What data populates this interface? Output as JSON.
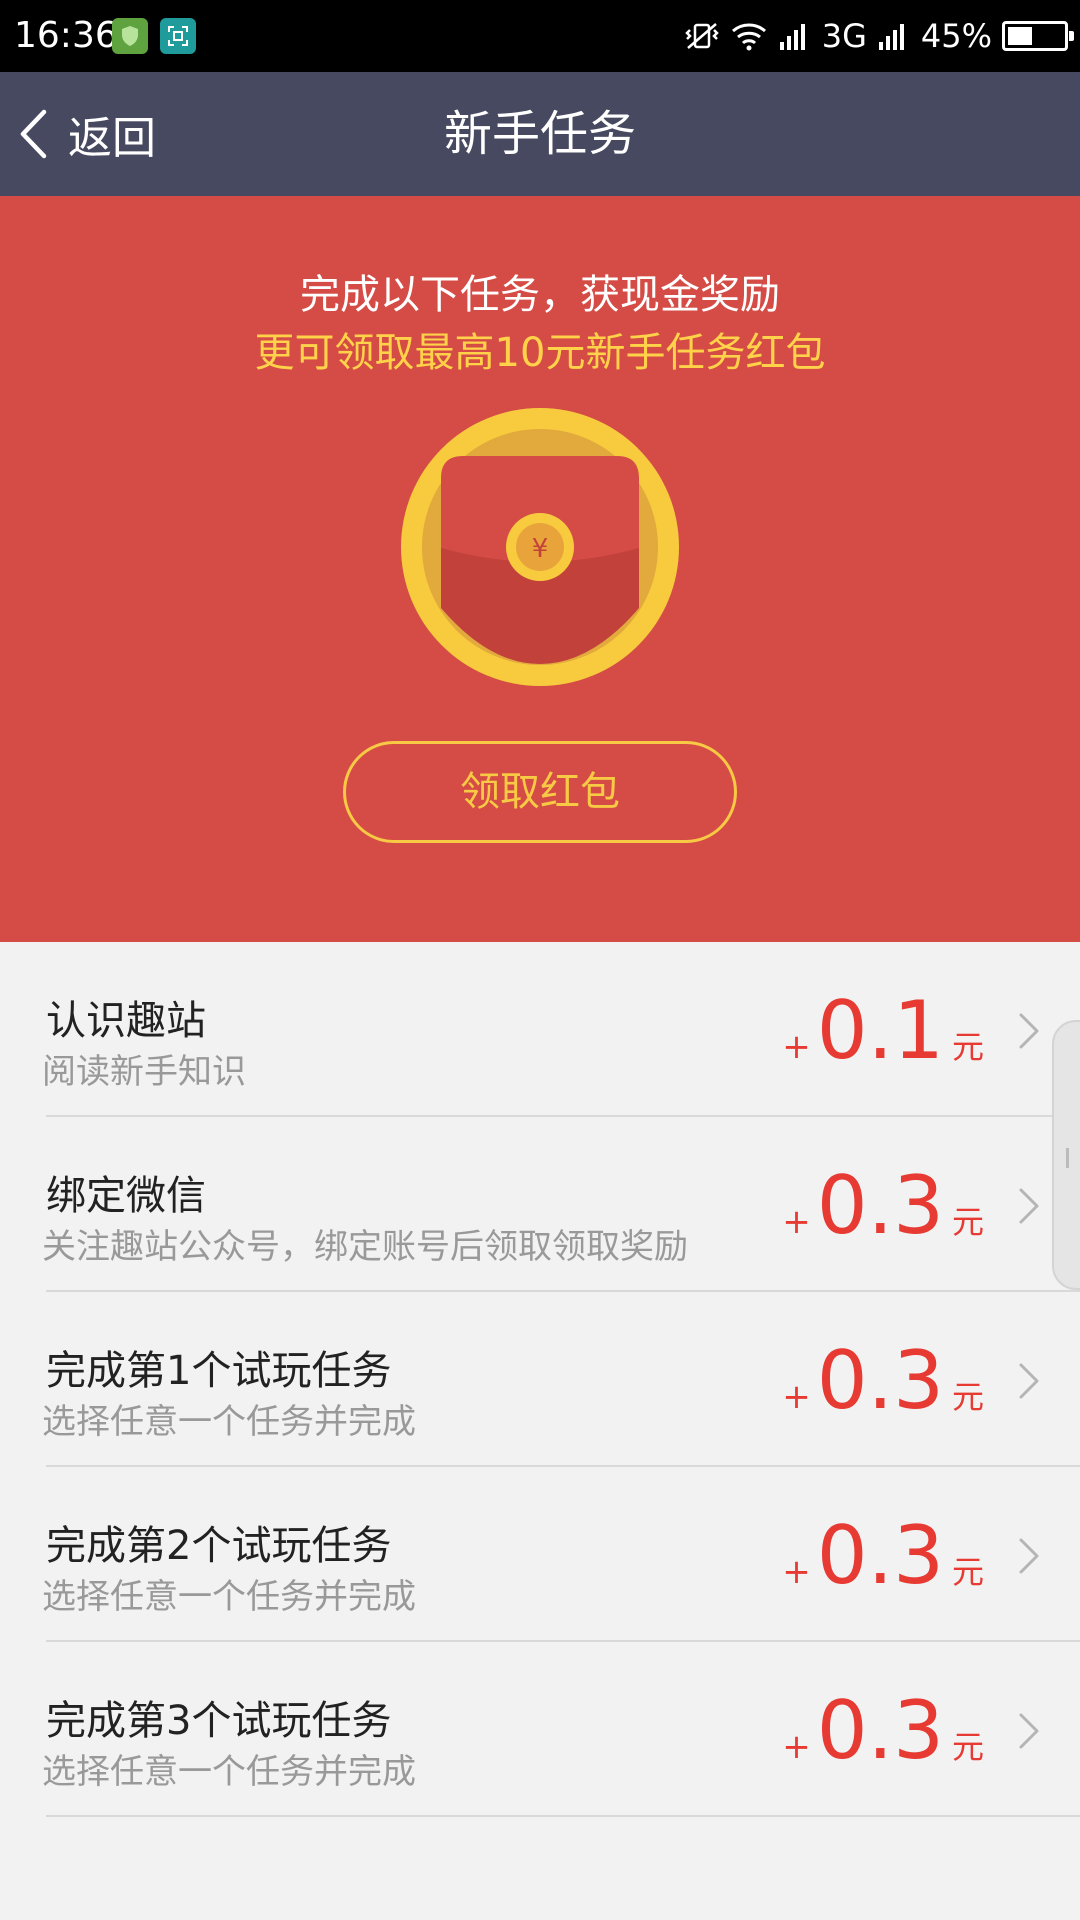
{
  "status_bar": {
    "time": "16:36",
    "network": "3G",
    "battery": "45%",
    "battery_level": 0.45,
    "icons": [
      "shield-app-icon",
      "scan-app-icon",
      "vibrate-icon",
      "wifi-icon",
      "signal-icon",
      "battery-icon"
    ]
  },
  "nav": {
    "back_label": "返回",
    "title": "新手任务"
  },
  "hero": {
    "headline": "完成以下任务，获现金奖励",
    "subline": "更可领取最高10元新手任务红包",
    "coin_symbol": "¥",
    "button_label": "领取红包"
  },
  "tasks": [
    {
      "title": "认识趣站",
      "desc": "阅读新手知识",
      "plus": "+",
      "amount": "0.1",
      "unit": "元"
    },
    {
      "title": "绑定微信",
      "desc": "关注趣站公众号，绑定账号后领取领取奖励",
      "plus": "+",
      "amount": "0.3",
      "unit": "元"
    },
    {
      "title": "完成第1个试玩任务",
      "desc": "选择任意一个任务并完成",
      "plus": "+",
      "amount": "0.3",
      "unit": "元"
    },
    {
      "title": "完成第2个试玩任务",
      "desc": "选择任意一个任务并完成",
      "plus": "+",
      "amount": "0.3",
      "unit": "元"
    },
    {
      "title": "完成第3个试玩任务",
      "desc": "选择任意一个任务并完成",
      "plus": "+",
      "amount": "0.3",
      "unit": "元"
    }
  ],
  "colors": {
    "nav_bg": "#474960",
    "hero_bg": "#d44c45",
    "accent_gold": "#f7c944",
    "reward_red": "#e63a33"
  }
}
